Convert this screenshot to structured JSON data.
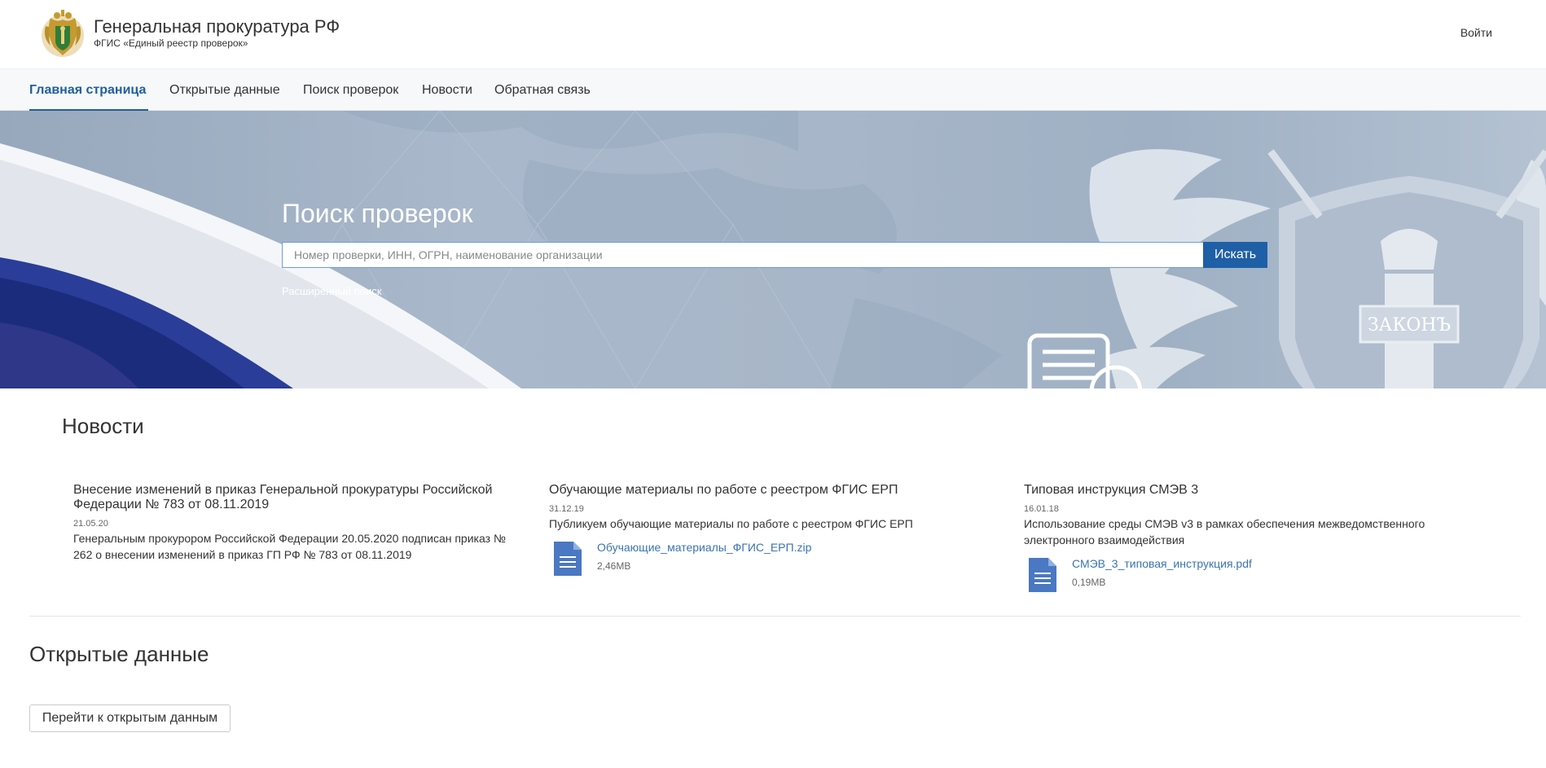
{
  "header": {
    "title": "Генеральная прокуратура РФ",
    "subtitle": "ФГИС «Единый реестр проверок»",
    "login": "Войти"
  },
  "nav": {
    "items": [
      {
        "label": "Главная страница",
        "active": true
      },
      {
        "label": "Открытые данные",
        "active": false
      },
      {
        "label": "Поиск проверок",
        "active": false
      },
      {
        "label": "Новости",
        "active": false
      },
      {
        "label": "Обратная связь",
        "active": false
      }
    ]
  },
  "hero": {
    "title": "Поиск проверок",
    "search_placeholder": "Номер проверки, ИНН, ОГРН, наименование организации",
    "search_value": "",
    "search_button": "Искать",
    "advanced_link": "Расширенный поиск",
    "emblem_text": "ЗАКОНЪ"
  },
  "news": {
    "title": "Новости",
    "items": [
      {
        "title": "Внесение изменений в приказ Генеральной прокуратуры Российской Федерации № 783 от 08.11.2019",
        "date": "21.05.20",
        "text": "Генеральным прокурором Российской Федерации 20.05.2020 подписан приказ № 262 о внесении изменений в приказ ГП РФ № 783 от 08.11.2019"
      },
      {
        "title": "Обучающие материалы по работе с реестром ФГИС ЕРП",
        "date": "31.12.19",
        "text": "Публикуем обучающие материалы по работе с реестром ФГИС ЕРП",
        "attachment": {
          "name": "Обучающие_материалы_ФГИС_ЕРП.zip",
          "size": "2,46MB"
        }
      },
      {
        "title": "Типовая инструкция СМЭВ 3",
        "date": "16.01.18",
        "text": "Использование среды СМЭВ v3 в рамках обеспечения межведомственного электронного взаимодействия",
        "attachment": {
          "name": "СМЭВ_3_типовая_инструкция.pdf",
          "size": "0,19MB"
        }
      }
    ]
  },
  "open_data": {
    "title": "Открытые данные",
    "button": "Перейти к открытым данным"
  },
  "colors": {
    "accent": "#1f5f9e",
    "search_button": "#1f5fa6",
    "link": "#3b73b3",
    "file_icon": "#4a78c2"
  },
  "icons": {
    "logo": "prosecutor-emblem",
    "file": "document-icon"
  }
}
